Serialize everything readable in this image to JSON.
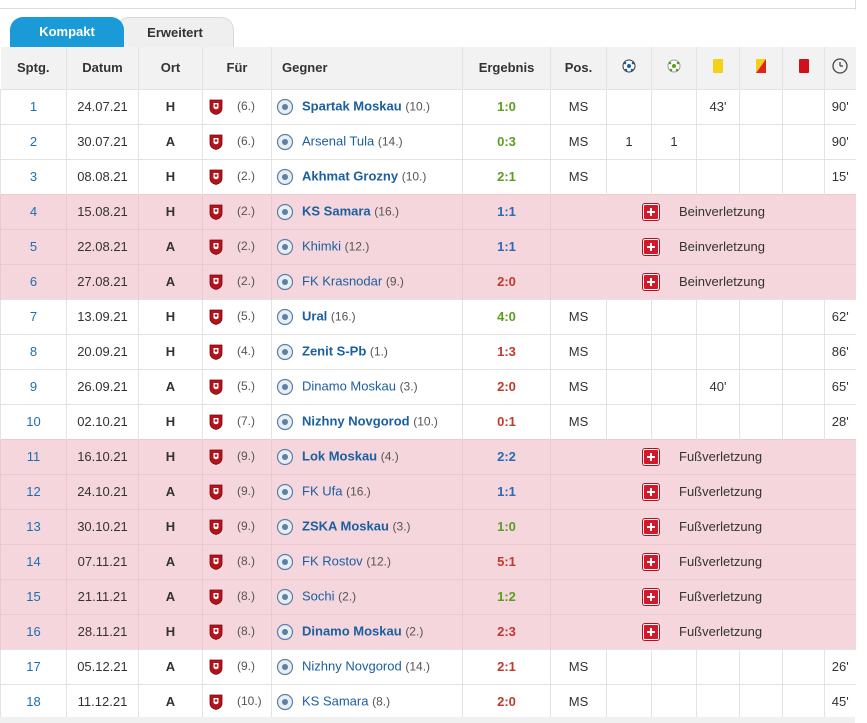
{
  "tabs": [
    {
      "label": "Kompakt",
      "active": true
    },
    {
      "label": "Erweitert",
      "active": false
    }
  ],
  "headers": {
    "spieltag": "Sptg.",
    "datum": "Datum",
    "ort": "Ort",
    "fuer": "Für",
    "gegner": "Gegner",
    "ergebnis": "Ergebnis",
    "pos": "Pos.",
    "goals_icon": "ball-icon",
    "assists_icon": "assist-ball-icon",
    "yellow_icon": "yellow-card-icon",
    "yellowred_icon": "yellow-red-card-icon",
    "red_icon": "red-card-icon",
    "minutes_icon": "clock-icon"
  },
  "colors": {
    "tab_active": "#1a9ad6",
    "injury_row": "#f5d6dc",
    "win": "#5a9e1e",
    "draw": "#2a6ab2",
    "loss": "#c0392b",
    "link": "#1a5fa0"
  },
  "rows": [
    {
      "spt": "1",
      "datum": "24.07.21",
      "ort": "H",
      "fuer_rank": "(6.)",
      "gegner": "Spartak Moskau",
      "gegner_rank": "(10.)",
      "bold": true,
      "ergebnis": "1:0",
      "res": "win",
      "pos": "MS",
      "goals": "",
      "assists": "",
      "yellow": "43'",
      "yellowred": "",
      "red": "",
      "minutes": "90'",
      "injury": ""
    },
    {
      "spt": "2",
      "datum": "30.07.21",
      "ort": "A",
      "fuer_rank": "(6.)",
      "gegner": "Arsenal Tula",
      "gegner_rank": "(14.)",
      "bold": false,
      "ergebnis": "0:3",
      "res": "win",
      "pos": "MS",
      "goals": "1",
      "assists": "1",
      "yellow": "",
      "yellowred": "",
      "red": "",
      "minutes": "90'",
      "injury": ""
    },
    {
      "spt": "3",
      "datum": "08.08.21",
      "ort": "H",
      "fuer_rank": "(2.)",
      "gegner": "Akhmat Grozny",
      "gegner_rank": "(10.)",
      "bold": true,
      "ergebnis": "2:1",
      "res": "win",
      "pos": "MS",
      "goals": "",
      "assists": "",
      "yellow": "",
      "yellowred": "",
      "red": "",
      "minutes": "15'",
      "injury": ""
    },
    {
      "spt": "4",
      "datum": "15.08.21",
      "ort": "H",
      "fuer_rank": "(2.)",
      "gegner": "KS Samara",
      "gegner_rank": "(16.)",
      "bold": true,
      "ergebnis": "1:1",
      "res": "draw",
      "pos": "",
      "goals": "",
      "assists": "",
      "yellow": "",
      "yellowred": "",
      "red": "",
      "minutes": "",
      "injury": "Beinverletzung"
    },
    {
      "spt": "5",
      "datum": "22.08.21",
      "ort": "A",
      "fuer_rank": "(2.)",
      "gegner": "Khimki",
      "gegner_rank": "(12.)",
      "bold": false,
      "ergebnis": "1:1",
      "res": "draw",
      "pos": "",
      "goals": "",
      "assists": "",
      "yellow": "",
      "yellowred": "",
      "red": "",
      "minutes": "",
      "injury": "Beinverletzung"
    },
    {
      "spt": "6",
      "datum": "27.08.21",
      "ort": "A",
      "fuer_rank": "(2.)",
      "gegner": "FK Krasnodar",
      "gegner_rank": "(9.)",
      "bold": false,
      "ergebnis": "2:0",
      "res": "loss",
      "pos": "",
      "goals": "",
      "assists": "",
      "yellow": "",
      "yellowred": "",
      "red": "",
      "minutes": "",
      "injury": "Beinverletzung"
    },
    {
      "spt": "7",
      "datum": "13.09.21",
      "ort": "H",
      "fuer_rank": "(5.)",
      "gegner": "Ural",
      "gegner_rank": "(16.)",
      "bold": true,
      "ergebnis": "4:0",
      "res": "win",
      "pos": "MS",
      "goals": "",
      "assists": "",
      "yellow": "",
      "yellowred": "",
      "red": "",
      "minutes": "62'",
      "injury": ""
    },
    {
      "spt": "8",
      "datum": "20.09.21",
      "ort": "H",
      "fuer_rank": "(4.)",
      "gegner": "Zenit S-Pb",
      "gegner_rank": "(1.)",
      "bold": true,
      "ergebnis": "1:3",
      "res": "loss",
      "pos": "MS",
      "goals": "",
      "assists": "",
      "yellow": "",
      "yellowred": "",
      "red": "",
      "minutes": "86'",
      "injury": ""
    },
    {
      "spt": "9",
      "datum": "26.09.21",
      "ort": "A",
      "fuer_rank": "(5.)",
      "gegner": "Dinamo Moskau",
      "gegner_rank": "(3.)",
      "bold": false,
      "ergebnis": "2:0",
      "res": "loss",
      "pos": "MS",
      "goals": "",
      "assists": "",
      "yellow": "40'",
      "yellowred": "",
      "red": "",
      "minutes": "65'",
      "injury": ""
    },
    {
      "spt": "10",
      "datum": "02.10.21",
      "ort": "H",
      "fuer_rank": "(7.)",
      "gegner": "Nizhny Novgorod",
      "gegner_rank": "(10.)",
      "bold": true,
      "ergebnis": "0:1",
      "res": "loss",
      "pos": "MS",
      "goals": "",
      "assists": "",
      "yellow": "",
      "yellowred": "",
      "red": "",
      "minutes": "28'",
      "injury": ""
    },
    {
      "spt": "11",
      "datum": "16.10.21",
      "ort": "H",
      "fuer_rank": "(9.)",
      "gegner": "Lok Moskau",
      "gegner_rank": "(4.)",
      "bold": true,
      "ergebnis": "2:2",
      "res": "draw",
      "pos": "",
      "goals": "",
      "assists": "",
      "yellow": "",
      "yellowred": "",
      "red": "",
      "minutes": "",
      "injury": "Fußverletzung"
    },
    {
      "spt": "12",
      "datum": "24.10.21",
      "ort": "A",
      "fuer_rank": "(9.)",
      "gegner": "FK Ufa",
      "gegner_rank": "(16.)",
      "bold": false,
      "ergebnis": "1:1",
      "res": "draw",
      "pos": "",
      "goals": "",
      "assists": "",
      "yellow": "",
      "yellowred": "",
      "red": "",
      "minutes": "",
      "injury": "Fußverletzung"
    },
    {
      "spt": "13",
      "datum": "30.10.21",
      "ort": "H",
      "fuer_rank": "(9.)",
      "gegner": "ZSKA Moskau",
      "gegner_rank": "(3.)",
      "bold": true,
      "ergebnis": "1:0",
      "res": "win",
      "pos": "",
      "goals": "",
      "assists": "",
      "yellow": "",
      "yellowred": "",
      "red": "",
      "minutes": "",
      "injury": "Fußverletzung"
    },
    {
      "spt": "14",
      "datum": "07.11.21",
      "ort": "A",
      "fuer_rank": "(8.)",
      "gegner": "FK Rostov",
      "gegner_rank": "(12.)",
      "bold": false,
      "ergebnis": "5:1",
      "res": "loss",
      "pos": "",
      "goals": "",
      "assists": "",
      "yellow": "",
      "yellowred": "",
      "red": "",
      "minutes": "",
      "injury": "Fußverletzung"
    },
    {
      "spt": "15",
      "datum": "21.11.21",
      "ort": "A",
      "fuer_rank": "(8.)",
      "gegner": "Sochi",
      "gegner_rank": "(2.)",
      "bold": false,
      "ergebnis": "1:2",
      "res": "win",
      "pos": "",
      "goals": "",
      "assists": "",
      "yellow": "",
      "yellowred": "",
      "red": "",
      "minutes": "",
      "injury": "Fußverletzung"
    },
    {
      "spt": "16",
      "datum": "28.11.21",
      "ort": "H",
      "fuer_rank": "(8.)",
      "gegner": "Dinamo Moskau",
      "gegner_rank": "(2.)",
      "bold": true,
      "ergebnis": "2:3",
      "res": "loss",
      "pos": "",
      "goals": "",
      "assists": "",
      "yellow": "",
      "yellowred": "",
      "red": "",
      "minutes": "",
      "injury": "Fußverletzung"
    },
    {
      "spt": "17",
      "datum": "05.12.21",
      "ort": "A",
      "fuer_rank": "(9.)",
      "gegner": "Nizhny Novgorod",
      "gegner_rank": "(14.)",
      "bold": false,
      "ergebnis": "2:1",
      "res": "loss",
      "pos": "MS",
      "goals": "",
      "assists": "",
      "yellow": "",
      "yellowred": "",
      "red": "",
      "minutes": "26'",
      "injury": ""
    },
    {
      "spt": "18",
      "datum": "11.12.21",
      "ort": "A",
      "fuer_rank": "(10.)",
      "gegner": "KS Samara",
      "gegner_rank": "(8.)",
      "bold": false,
      "ergebnis": "2:0",
      "res": "loss",
      "pos": "MS",
      "goals": "",
      "assists": "",
      "yellow": "",
      "yellowred": "",
      "red": "",
      "minutes": "45'",
      "injury": ""
    }
  ]
}
